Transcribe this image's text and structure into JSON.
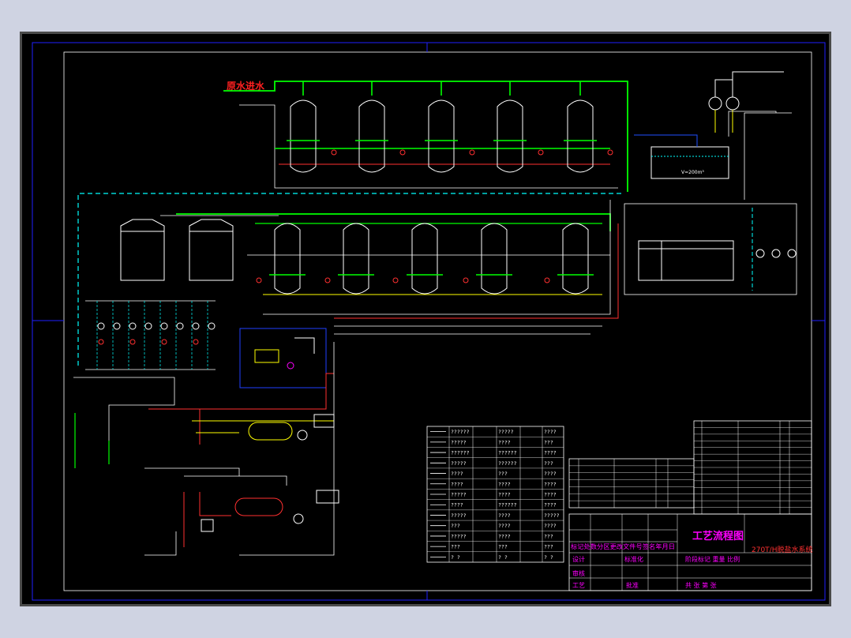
{
  "sheet": {
    "source_label": "原水进水",
    "drawing_title": "工艺流程图",
    "system_name": "270T/H脱盐水系统",
    "tank_volume": "V=200m³"
  },
  "title_block": {
    "header_row": "标记处数分区更改文件号签名年月日",
    "design": "设计",
    "standardize": "标准化",
    "review": "审核",
    "process": "工艺",
    "approve": "批准",
    "stage_mark": "阶段标记 重量 比例",
    "sheet_count": "共 张 第 张"
  },
  "legend": {
    "rows": [
      [
        "??????",
        "?????",
        "????"
      ],
      [
        "?????",
        "????",
        "???"
      ],
      [
        "??????",
        "??????",
        "????"
      ],
      [
        "?????",
        "??????",
        "???"
      ],
      [
        "????",
        "???",
        "????"
      ],
      [
        "????",
        "????",
        "????"
      ],
      [
        "?????",
        "????",
        "????"
      ],
      [
        "????",
        "??????",
        "????"
      ],
      [
        "?????",
        "????",
        "?????"
      ],
      [
        "???",
        "????",
        "????"
      ],
      [
        "?????",
        "????",
        "???"
      ],
      [
        "???",
        "???",
        "???"
      ],
      [
        "? ?",
        "? ?",
        "? ?"
      ]
    ]
  },
  "colors": {
    "background": "#000000",
    "border": "#0000ff",
    "process_line": "#00ff00",
    "water_line": "#ffffff",
    "chemical_line": "#00ffff",
    "waste_line": "#ff3030",
    "air_line": "#ffff00",
    "title_text": "#ff00ff",
    "label_text": "#ff2020"
  }
}
